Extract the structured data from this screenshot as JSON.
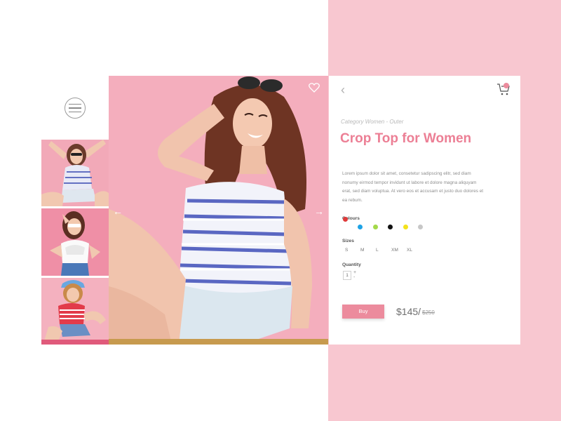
{
  "product": {
    "category": "Category Women - Outer",
    "title": "Crop Top for Women",
    "description": "Lorem ipsum dolor sit amet, consetetur sadipscing elitr, sed diam nonumy eirmod tempor invidunt ut labore et dolore magna aliquyam erat, sed diam voluptua. At vero eos et accusam et justo duo dolores et ea rebum.",
    "colours_label": "Colours",
    "colours": [
      "#e03b3b",
      "#1ea3e6",
      "#a4d94a",
      "#111111",
      "#f3e21c",
      "#c7c7c7"
    ],
    "sizes_label": "Sizes",
    "sizes": [
      "S",
      "M",
      "L",
      "XM",
      "XL"
    ],
    "quantity_label": "Quantity",
    "quantity": "1",
    "buy_label": "Buy",
    "price": "$145/",
    "old_price": "$250"
  },
  "icons": {
    "menu": "hamburger-menu-icon",
    "prev": "arrow-left-icon",
    "next": "arrow-right-icon",
    "wishlist": "heart-icon",
    "back": "chevron-left-icon",
    "cart": "cart-icon"
  },
  "glyphs": {
    "prev": "←",
    "next": "→",
    "back": "‹",
    "plus": "+",
    "minus": "-"
  },
  "theme": {
    "accent": "#ec7f95",
    "pink_bg": "#f8c7d0",
    "photo_bg": "#f4aebd"
  }
}
